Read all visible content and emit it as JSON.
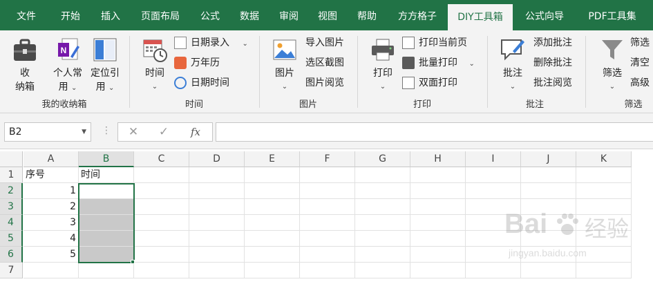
{
  "tabs": [
    {
      "label": "文件"
    },
    {
      "label": "开始"
    },
    {
      "label": "插入"
    },
    {
      "label": "页面布局"
    },
    {
      "label": "公式"
    },
    {
      "label": "数据"
    },
    {
      "label": "审阅"
    },
    {
      "label": "视图"
    },
    {
      "label": "帮助"
    },
    {
      "label": "方方格子"
    },
    {
      "label": "DIY工具箱"
    },
    {
      "label": "公式向导"
    },
    {
      "label": "PDF工具集"
    }
  ],
  "active_tab": "DIY工具箱",
  "ribbon": {
    "storage": {
      "label": "我的收纳箱",
      "storage_btn": {
        "line1": "收",
        "line2": "纳箱"
      },
      "personal_btn": {
        "line1": "个人常",
        "line2": "用"
      },
      "position_btn": {
        "line1": "定位引",
        "line2": "用"
      }
    },
    "time": {
      "label": "时间",
      "time_btn": "时间",
      "date_entry": "日期录入",
      "calendar": "万年历",
      "date_time": "日期时间"
    },
    "picture": {
      "label": "图片",
      "picture_btn": "图片",
      "import_pic": "导入图片",
      "region_shot": "选区截图",
      "pic_view": "图片阅览"
    },
    "print": {
      "label": "打印",
      "print_btn": "打印",
      "print_current": "打印当前页",
      "batch_print": "批量打印",
      "duplex_print": "双面打印"
    },
    "comment": {
      "label": "批注",
      "comment_btn": "批注",
      "add_comment": "添加批注",
      "delete_comment": "删除批注",
      "view_comment": "批注阅览"
    },
    "filter": {
      "label": "筛选",
      "filter_btn": "筛选",
      "filter_item1": "筛选",
      "filter_item2": "清空",
      "filter_item3": "高级"
    }
  },
  "formula_bar": {
    "name_box": "B2",
    "cancel": "✕",
    "enter": "✓",
    "fx": "fx",
    "value": ""
  },
  "sheet": {
    "columns": [
      "A",
      "B",
      "C",
      "D",
      "E",
      "F",
      "G",
      "H",
      "I",
      "J",
      "K"
    ],
    "rows": [
      "1",
      "2",
      "3",
      "4",
      "5",
      "6",
      "7"
    ],
    "cells": {
      "A1": "序号",
      "B1": "时间",
      "A2": "1",
      "A3": "2",
      "A4": "3",
      "A5": "4",
      "A6": "5"
    },
    "selected_column": "B",
    "selected_range": "B2:B6"
  },
  "watermark": {
    "brand": "Bai",
    "brand2": "经验",
    "url": "jingyan.baidu.com"
  },
  "colors": {
    "excel_green": "#217346",
    "ribbon_bg": "#f3f3f3",
    "selection_fill": "#c9c9c9"
  }
}
